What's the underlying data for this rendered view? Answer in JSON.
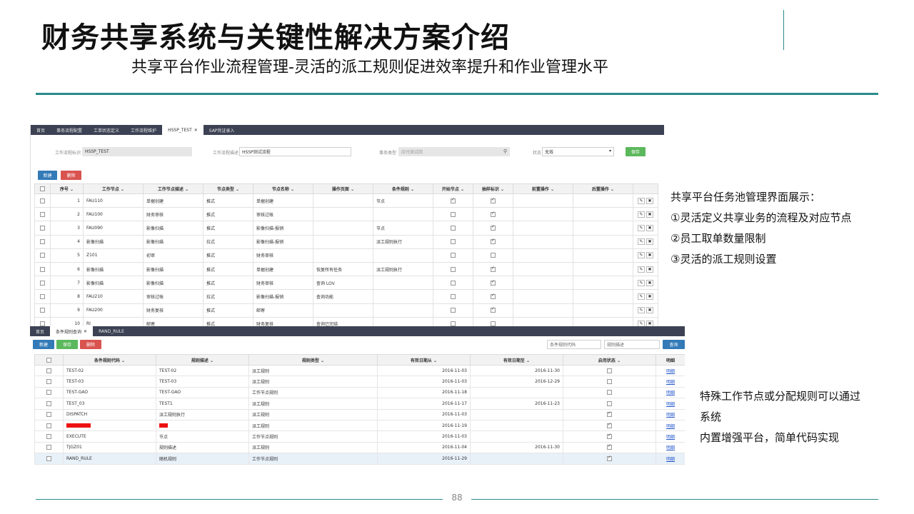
{
  "title": "财务共享系统与关键性解决方案介绍",
  "subtitle": "共享平台作业流程管理-灵活的派工规则促进效率提升和作业管理水平",
  "page_number": "88",
  "note1": [
    "共享平台任务池管理界面展示：",
    "①灵活定义共享业务的流程及对应节点",
    "②员工取单数量限制",
    "③灵活的派工规则设置"
  ],
  "note2": [
    "特殊工作节点或分配规则可以通过",
    "系统",
    "内置增强平台，简单代码实现"
  ],
  "colors": {
    "accent": "#2a8a8a",
    "tabbar": "#3c4254",
    "btn_blue": "#337ab7",
    "btn_red": "#d9534f",
    "btn_green": "#5cb85c"
  },
  "shot1": {
    "tabs": [
      {
        "label": "首页",
        "active": false,
        "closable": false
      },
      {
        "label": "事务流程配置",
        "active": false,
        "closable": false
      },
      {
        "label": "工单状态定义",
        "active": false,
        "closable": false
      },
      {
        "label": "工作流程维护",
        "active": false,
        "closable": false
      },
      {
        "label": "HSSP_TEST",
        "active": true,
        "closable": true
      },
      {
        "label": "SAP凭证录入",
        "active": false,
        "closable": false
      }
    ],
    "form": {
      "flow_id_label": "工作流程标识",
      "flow_id_value": "HSSP_TEST",
      "flow_desc_label": "工作流程描述",
      "flow_desc_value": "HSSP测试流程",
      "biz_type_label": "事务类型",
      "biz_type_value": "应付测试岗",
      "status_label": "状态",
      "status_value": "无效",
      "save_label": "保存"
    },
    "new_label": "新建",
    "delete_label": "删除",
    "columns": [
      "序号",
      "工作节点",
      "工作节点描述",
      "节点类型",
      "节点名称",
      "操作页面",
      "条件规则",
      "开始节点",
      "抽样标识",
      "前置操作",
      "后置操作"
    ],
    "rows": [
      {
        "seq": "1",
        "node": "FAU110",
        "desc": "单据创建",
        "type": "推式",
        "name": "单据创建",
        "page": "",
        "rule": "节点",
        "start": true,
        "sample": true
      },
      {
        "seq": "2",
        "node": "FAU100",
        "desc": "财务审核",
        "type": "推式",
        "name": "审核过帐",
        "page": "",
        "rule": "",
        "start": false,
        "sample": true
      },
      {
        "seq": "3",
        "node": "FAU090",
        "desc": "影像扫描",
        "type": "推式",
        "name": "影像扫描-报销",
        "page": "",
        "rule": "节点",
        "start": false,
        "sample": true
      },
      {
        "seq": "4",
        "node": "影像扫描",
        "desc": "影像扫描",
        "type": "拉式",
        "name": "影像扫描-报销",
        "page": "",
        "rule": "派工规则执行",
        "start": false,
        "sample": true
      },
      {
        "seq": "5",
        "node": "Z101",
        "desc": "初审",
        "type": "推式",
        "name": "财务审核",
        "page": "",
        "rule": "",
        "start": false,
        "sample": false
      },
      {
        "seq": "6",
        "node": "影像扫描",
        "desc": "影像扫描",
        "type": "推式",
        "name": "单据创建",
        "page": "恢复所有任务",
        "rule": "派工规则执行",
        "start": false,
        "sample": true
      },
      {
        "seq": "7",
        "node": "影像扫描",
        "desc": "影像扫描",
        "type": "推式",
        "name": "财务审核",
        "page": "查询 LOV",
        "rule": "",
        "start": false,
        "sample": true
      },
      {
        "seq": "8",
        "node": "FAU210",
        "desc": "审核过帐",
        "type": "拉式",
        "name": "影像扫描-报销",
        "page": "查询功能",
        "rule": "",
        "start": false,
        "sample": true
      },
      {
        "seq": "9",
        "node": "FAU200",
        "desc": "财务复核",
        "type": "推式",
        "name": "邮寄",
        "page": "",
        "rule": "",
        "start": false,
        "sample": true
      },
      {
        "seq": "10",
        "node": "RI",
        "desc": "邮寄",
        "type": "推式",
        "name": "财务复核",
        "page": "查询已完结",
        "rule": "",
        "start": false,
        "sample": false
      }
    ]
  },
  "shot2": {
    "tabs": [
      {
        "label": "首页",
        "active": false,
        "closable": false
      },
      {
        "label": "条件规则查询",
        "active": true,
        "closable": true
      },
      {
        "label": "RAND_RULE",
        "active": false,
        "closable": false
      }
    ],
    "new_label": "新建",
    "save_label": "保存",
    "delete_label": "删除",
    "filter_code_placeholder": "条件规则代码",
    "filter_desc_placeholder": "规则描述",
    "query_label": "查询",
    "columns": [
      "条件规则代码",
      "规则描述",
      "规则类型",
      "有效日期从",
      "有效日期至",
      "启用状态",
      "明细"
    ],
    "rows": [
      {
        "code": "TEST-02",
        "desc": "TEST-02",
        "type": "派工规则",
        "from": "2016-11-03",
        "to": "2016-11-30",
        "enabled": false,
        "detail": "明细",
        "redacted": false,
        "highlight": false
      },
      {
        "code": "TEST-03",
        "desc": "TEST-03",
        "type": "派工规则",
        "from": "2016-11-03",
        "to": "2016-12-29",
        "enabled": false,
        "detail": "明细",
        "redacted": false,
        "highlight": false
      },
      {
        "code": "TEST-GAO",
        "desc": "TEST-GAO",
        "type": "工作节点规则",
        "from": "2016-11-18",
        "to": "",
        "enabled": false,
        "detail": "明细",
        "redacted": false,
        "highlight": false
      },
      {
        "code": "TEST_03",
        "desc": "TEST1",
        "type": "派工规则",
        "from": "2016-11-17",
        "to": "2016-11-23",
        "enabled": false,
        "detail": "明细",
        "redacted": false,
        "highlight": false
      },
      {
        "code": "DISPATCH",
        "desc": "派工规则执行",
        "type": "派工规则",
        "from": "2016-11-03",
        "to": "",
        "enabled": true,
        "detail": "明细",
        "redacted": false,
        "highlight": false
      },
      {
        "code": "",
        "desc": "",
        "type": "派工规则",
        "from": "2016-11-19",
        "to": "",
        "enabled": true,
        "detail": "明细",
        "redacted": true,
        "highlight": false
      },
      {
        "code": "EXECUTE",
        "desc": "节点",
        "type": "工作节点规则",
        "from": "2016-11-03",
        "to": "",
        "enabled": true,
        "detail": "明细",
        "redacted": false,
        "highlight": false
      },
      {
        "code": "TJGZ01",
        "desc": "规则描述",
        "type": "派工规则",
        "from": "2016-11-04",
        "to": "2016-11-30",
        "enabled": true,
        "detail": "明细",
        "redacted": false,
        "highlight": false
      },
      {
        "code": "RAND_RULE",
        "desc": "随机规则",
        "type": "工作节点规则",
        "from": "2016-11-29",
        "to": "",
        "enabled": true,
        "detail": "明细",
        "redacted": false,
        "highlight": true
      }
    ]
  }
}
